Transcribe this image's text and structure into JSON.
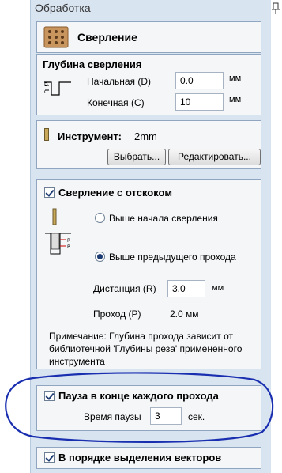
{
  "panel": {
    "title": "Обработка"
  },
  "header": {
    "title": "Сверление"
  },
  "depth": {
    "title": "Глубина сверления",
    "start_label": "Начальная (D)",
    "start_value": "0.0",
    "end_label": "Конечная (C)",
    "end_value": "10",
    "unit": "мм"
  },
  "tool": {
    "label": "Инструмент:",
    "value": "2mm",
    "select_button": "Выбрать...",
    "edit_button": "Редактировать..."
  },
  "peck": {
    "title": "Сверление с отскоком",
    "option_above_start": "Выше начала сверления",
    "option_above_prev": "Выше предыдущего прохода",
    "distance_label": "Дистанция (R)",
    "distance_value": "3.0",
    "distance_unit": "мм",
    "pass_label": "Проход (P)",
    "pass_value": "2.0 мм",
    "note_line1": "Примечание: Глубина прохода зависит от",
    "note_line2": "библиотечной 'Глубины реза' примененного",
    "note_line3": "инструмента"
  },
  "pause": {
    "title": "Пауза в конце каждого прохода",
    "time_label": "Время паузы",
    "time_value": "3",
    "time_unit": "сек."
  },
  "order": {
    "title": "В порядке выделения векторов"
  },
  "colors": {
    "panel_bg": "#d9e4f1",
    "card_bg": "#f4f6f8",
    "annotation_ellipse": "#1a2fb0"
  }
}
